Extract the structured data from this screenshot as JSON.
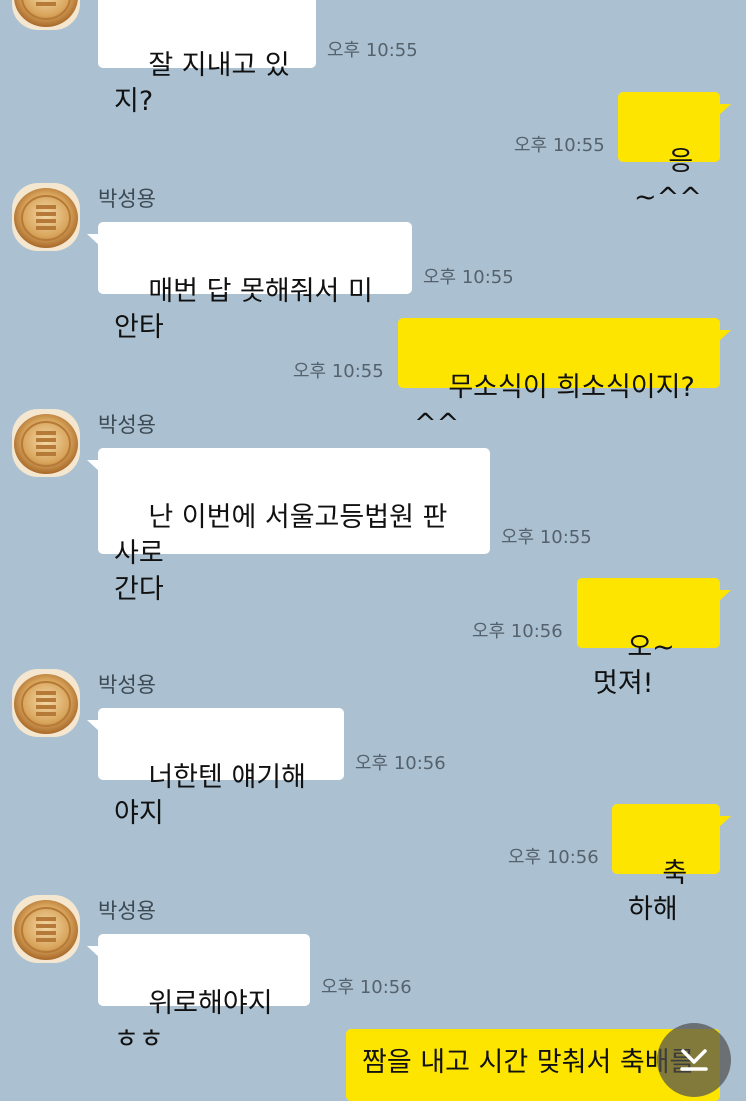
{
  "sender": "박성용",
  "messages": [
    {
      "id": "m1",
      "side": "in",
      "text": "잘 지내고 있지?",
      "time": "오후 10:55",
      "show_profile": false
    },
    {
      "id": "m2",
      "side": "out",
      "text": "응~^^",
      "time": "오후 10:55"
    },
    {
      "id": "m3",
      "side": "in",
      "text": "매번 답 못해줘서 미안타",
      "time": "오후 10:55",
      "show_profile": true
    },
    {
      "id": "m4",
      "side": "out",
      "text": "무소식이 희소식이지? ^^",
      "time": "오후 10:55"
    },
    {
      "id": "m5",
      "side": "in",
      "text": "난 이번에 서울고등법원 판사로\n간다",
      "time": "오후 10:55",
      "show_profile": true
    },
    {
      "id": "m6",
      "side": "out",
      "text": "오~ 멋져!",
      "time": "오후 10:56"
    },
    {
      "id": "m7",
      "side": "in",
      "text": "너한텐 얘기해야지",
      "time": "오후 10:56",
      "show_profile": true
    },
    {
      "id": "m8",
      "side": "out",
      "text": "축하해",
      "time": "오후 10:56"
    },
    {
      "id": "m9",
      "side": "in",
      "text": "위로해야지ㅎㅎ",
      "time": "오후 10:56",
      "show_profile": true
    },
    {
      "id": "m10",
      "side": "out",
      "text": "짬을 내고 시간 맞춰서 축배를",
      "time": ""
    }
  ],
  "colors": {
    "background": "#abc1d1",
    "incoming_bubble": "#ffffff",
    "outgoing_bubble": "#fee500",
    "timestamp": "#55626d"
  },
  "icons": {
    "avatar": "mooncake-avatar-icon",
    "scroll": "chevron-down-icon"
  }
}
